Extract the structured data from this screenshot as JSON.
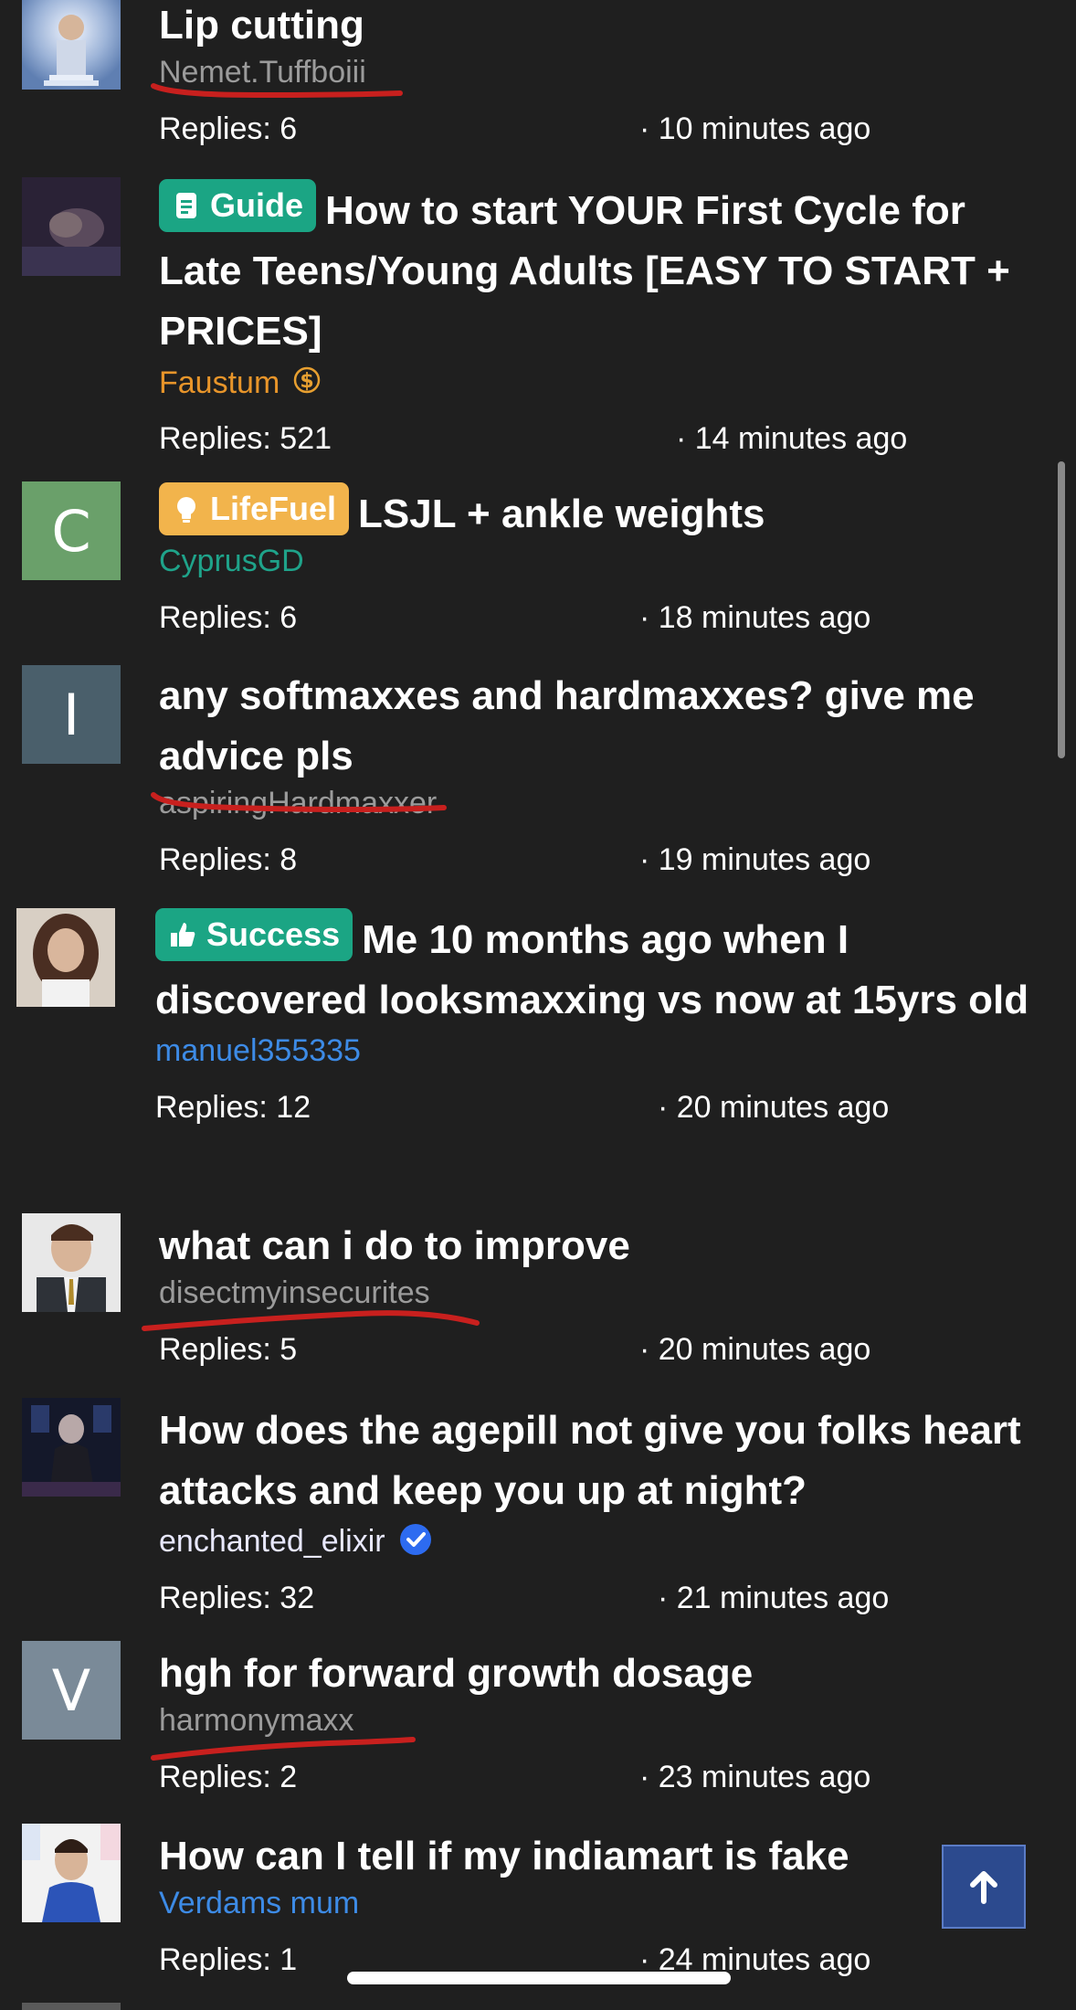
{
  "threads": [
    {
      "avatar": "photo",
      "avatar_letter": "",
      "prefix": "",
      "title": "Lip cutting",
      "author": "Nemet.Tuffboiii",
      "replies": "Replies: 6",
      "time": "· 10 minutes ago"
    },
    {
      "avatar": "photo",
      "avatar_letter": "",
      "prefix": "Guide",
      "title": "How to start YOUR First Cycle for Late Teens/Young Adults [EASY TO START + PRICES]",
      "author": "Faustum",
      "author_badge": "dollar-icon",
      "replies": "Replies: 521",
      "time": "· 14 minutes ago"
    },
    {
      "avatar": "letter",
      "avatar_letter": "C",
      "avatar_color": "#6aa06a",
      "prefix": "LifeFuel",
      "title": "LSJL + ankle weights",
      "author": "CyprusGD",
      "replies": "Replies: 6",
      "time": "· 18 minutes ago"
    },
    {
      "avatar": "letter",
      "avatar_letter": "I",
      "avatar_color": "#4a5f6b",
      "prefix": "",
      "title": "any softmaxxes and hardmaxxes? give me advice pls",
      "author": "aspiringHardmaxxer",
      "replies": "Replies: 8",
      "time": "· 19 minutes ago"
    },
    {
      "avatar": "photo",
      "avatar_letter": "",
      "prefix": "Success",
      "title": "Me 10 months ago when I discovered looksmaxxing vs now at 15yrs old",
      "author": "manuel355335",
      "replies": "Replies: 12",
      "time": "· 20 minutes ago"
    },
    {
      "avatar": "photo",
      "avatar_letter": "",
      "prefix": "",
      "title": "what can i do to improve",
      "author": "disectmyinsecurites",
      "replies": "Replies: 5",
      "time": "· 20 minutes ago"
    },
    {
      "avatar": "photo",
      "avatar_letter": "",
      "prefix": "",
      "title": "How does the agepill not give you folks heart attacks and keep you up at night?",
      "author": "enchanted_elixir",
      "author_badge": "verified-icon",
      "replies": "Replies: 32",
      "time": "· 21 minutes ago"
    },
    {
      "avatar": "letter",
      "avatar_letter": "V",
      "avatar_color": "#7a8a98",
      "prefix": "",
      "title": "hgh for forward growth dosage",
      "author": "harmonymaxx",
      "replies": "Replies: 2",
      "time": "· 23 minutes ago"
    },
    {
      "avatar": "photo",
      "avatar_letter": "",
      "prefix": "",
      "title": "How can I tell if my indiamart is fake",
      "author": "Verdams mum",
      "replies": "Replies: 1",
      "time": "· 24 minutes ago"
    }
  ],
  "controls": {
    "back_to_top": "arrow-up-icon"
  },
  "colors": {
    "background": "#1f1f1f",
    "guide_badge": "#1ba584",
    "lifefuel_badge": "#f2b44c",
    "success_badge": "#1ba584",
    "orange_author": "#e8952a",
    "teal_author": "#1fa38a",
    "blue_author": "#3d8be6",
    "red_annotation": "#c8201e"
  }
}
